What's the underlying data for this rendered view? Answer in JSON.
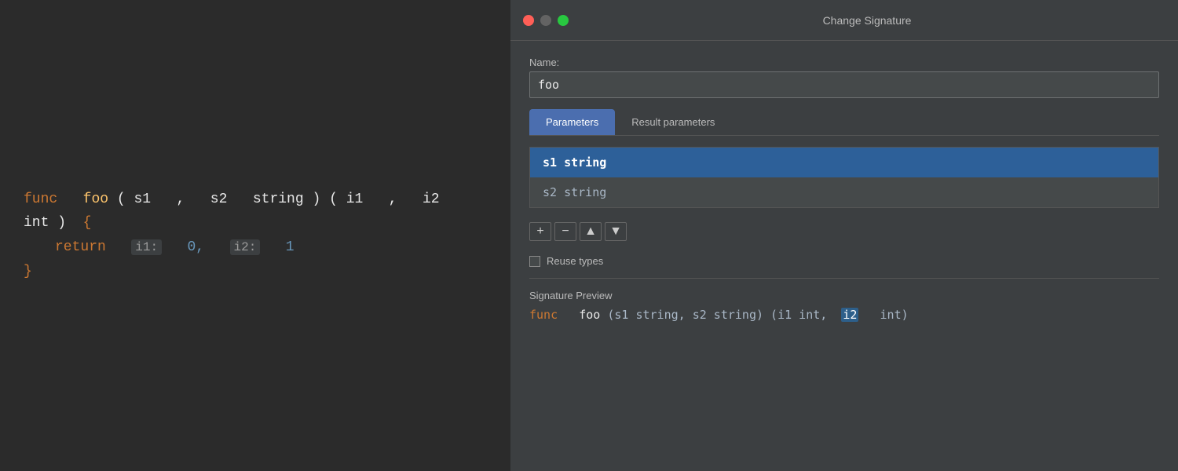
{
  "editor": {
    "code": {
      "line1_kw": "func",
      "line1_fn": "foo",
      "line1_p1": "s1",
      "line1_sep1": ",",
      "line1_p2": "s2",
      "line1_type1": "string",
      "line1_p3": "i1",
      "line1_sep2": ",",
      "line1_p4": "i2",
      "line1_type2": "int",
      "line1_brace": "{",
      "line2_kw": "return",
      "line2_l1": "i1:",
      "line2_v1": "0,",
      "line2_l2": "i2:",
      "line2_v2": "1",
      "line3_brace": "}"
    }
  },
  "dialog": {
    "title": "Change Signature",
    "name_label": "Name:",
    "name_value": "foo",
    "tabs": [
      {
        "id": "parameters",
        "label": "Parameters",
        "active": true
      },
      {
        "id": "result-parameters",
        "label": "Result parameters",
        "active": false
      }
    ],
    "parameters": [
      {
        "id": "p1",
        "text": "s1  string",
        "selected": true
      },
      {
        "id": "p2",
        "text": "s2  string",
        "selected": false
      }
    ],
    "toolbar": {
      "add": "+",
      "remove": "−",
      "up": "▲",
      "down": "▼"
    },
    "reuse_types_label": "Reuse types",
    "preview": {
      "title": "Signature Preview",
      "kw": "func",
      "fn": "foo",
      "params": "(s1 string, s2 string) (i1 int,",
      "highlight": "i2",
      "rest": "int)"
    }
  },
  "traffic_lights": {
    "close_label": "close",
    "minimize_label": "minimize",
    "maximize_label": "maximize"
  }
}
